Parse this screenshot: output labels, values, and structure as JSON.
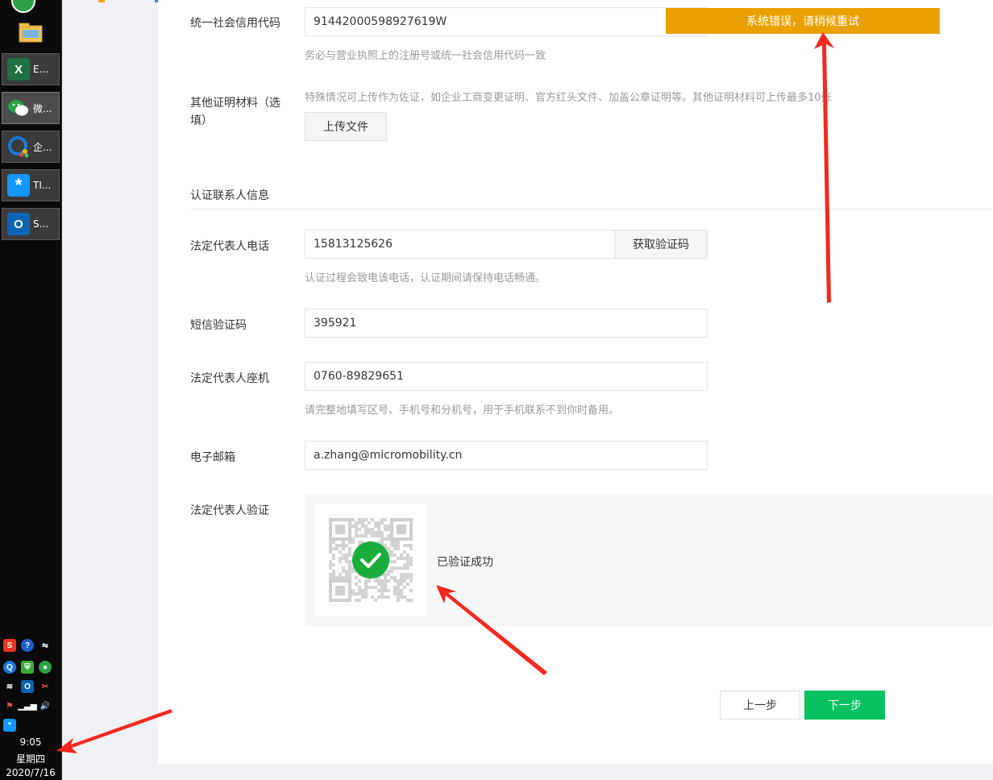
{
  "taskbar": {
    "apps": [
      {
        "label": "E...",
        "icon": "excel-icon",
        "glyph": "X",
        "color": "#1e7145"
      },
      {
        "label": "微...",
        "icon": "wechat-icon",
        "glyph": "",
        "color": "#2ba245"
      },
      {
        "label": "企...",
        "icon": "wecom-icon",
        "glyph": "",
        "color": "#1b79d7"
      },
      {
        "label": "TI...",
        "icon": "tim-icon",
        "glyph": "*",
        "color": "#1296ff"
      },
      {
        "label": "S...",
        "icon": "outlook-icon",
        "glyph": "O",
        "color": "#0a64b3"
      }
    ],
    "clock": {
      "time": "9:05",
      "weekday": "星期四",
      "date": "2020/7/16"
    }
  },
  "form": {
    "credit_code": {
      "label": "统一社会信用代码",
      "value": "91442000598927619W",
      "hint": "务必与营业执照上的注册号或统一社会信用代码一致"
    },
    "other_docs": {
      "label_line1": "其他证明材料（选",
      "label_line2": "填）",
      "hint": "特殊情况可上传作为佐证，如企业工商变更证明、官方红头文件、加盖公章证明等。其他证明材料可上传最多10张",
      "upload_button": "上传文件"
    },
    "contact_section_title": "认证联系人信息",
    "legal_phone": {
      "label": "法定代表人电话",
      "value": "15813125626",
      "code_button": "获取验证码",
      "hint": "认证过程会致电该电话，认证期间请保持电话畅通。"
    },
    "sms_code": {
      "label": "短信验证码",
      "value": "395921"
    },
    "landline": {
      "label": "法定代表人座机",
      "value": "0760-89829651",
      "hint": "请完整地填写区号、手机号和分机号，用于手机联系不到你时备用。"
    },
    "email": {
      "label": "电子邮箱",
      "value": "a.zhang@micromobility.cn"
    },
    "verify": {
      "label": "法定代表人验证",
      "status": "已验证成功"
    },
    "prev_button": "上一步",
    "next_button": "下一步"
  },
  "toast": {
    "message": "系统错误，请稍候重试",
    "color": "#e9a100"
  },
  "colors": {
    "primary": "#07c160",
    "success": "#1aad3c",
    "annotation_arrow": "#f5281e"
  }
}
